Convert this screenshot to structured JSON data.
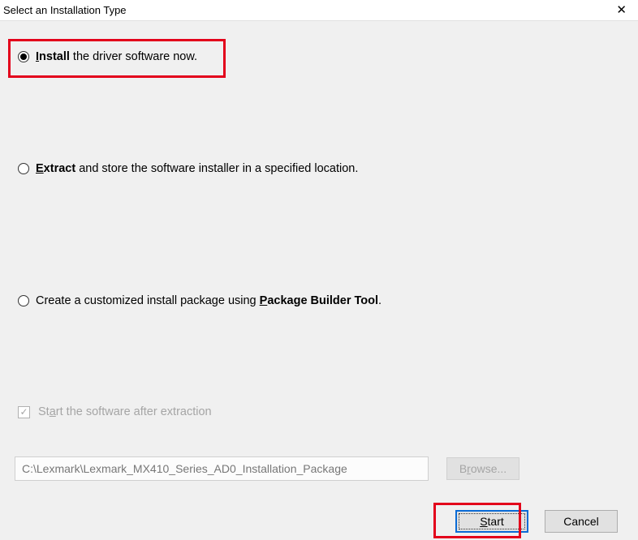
{
  "window": {
    "title": "Select an Installation Type"
  },
  "options": {
    "install": {
      "bold": "Install",
      "underlineChar": "I",
      "rest": " the driver software now.",
      "selected": true
    },
    "extract": {
      "bold": "Extract",
      "underlineChar": "E",
      "rest": " and store the software installer in a specified location.",
      "selected": false
    },
    "package": {
      "prefix": "Create a customized install package using ",
      "bold": "Package Builder Tool",
      "underlineChar": "P",
      "suffix": ".",
      "selected": false
    }
  },
  "checkbox": {
    "label_pre": "St",
    "label_underline": "a",
    "label_post": "rt the software after extraction",
    "checked": true,
    "disabled": true
  },
  "path": {
    "value": "C:\\Lexmark\\Lexmark_MX410_Series_AD0_Installation_Package",
    "disabled": true
  },
  "buttons": {
    "browse_pre": "B",
    "browse_u": "r",
    "browse_post": "owse...",
    "start_pre": "",
    "start_u": "S",
    "start_post": "tart",
    "cancel": "Cancel"
  }
}
